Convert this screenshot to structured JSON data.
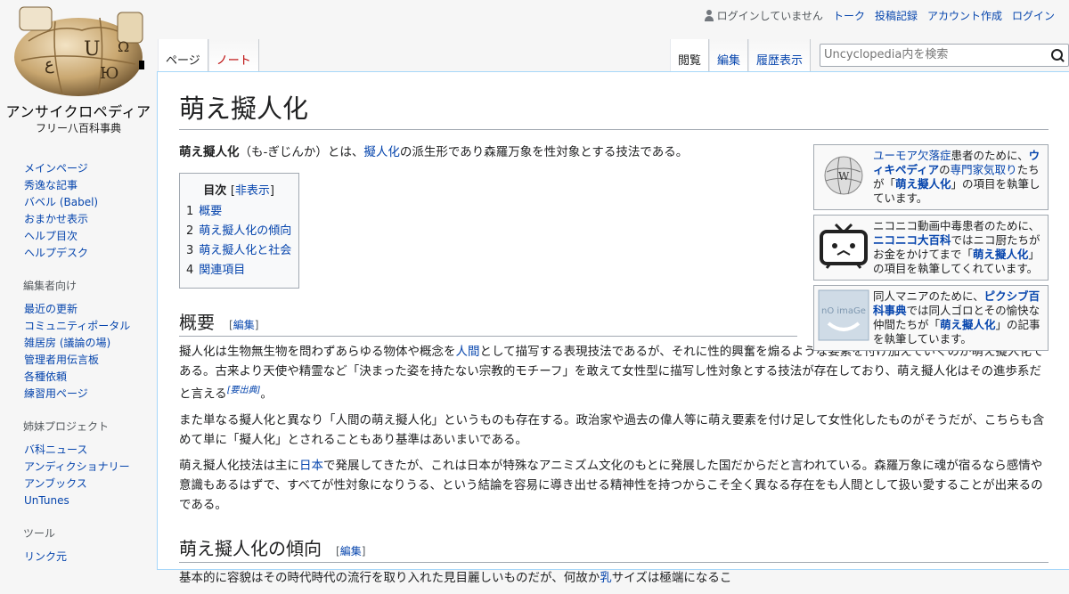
{
  "personal": {
    "not_logged_in": "ログインしていません",
    "talk": "トーク",
    "contributions": "投稿記録",
    "create_account": "アカウント作成",
    "login": "ログイン"
  },
  "logo": {
    "site_name": "アンサイクロペディア",
    "tagline": "フリー八百科事典"
  },
  "sidebar": {
    "nav": [
      "メインページ",
      "秀逸な記事",
      "バベル (Babel)",
      "おまかせ表示",
      "ヘルプ目次",
      "ヘルプデスク"
    ],
    "editors": {
      "heading": "編集者向け",
      "items": [
        "最近の更新",
        "コミュニティポータル",
        "雑居房 (議論の場)",
        "管理者用伝言板",
        "各種依頼",
        "練習用ページ"
      ]
    },
    "sister": {
      "heading": "姉妹プロジェクト",
      "items": [
        "バ科ニュース",
        "アンディクショナリー",
        "アンブックス",
        "UnTunes"
      ]
    },
    "tools": {
      "heading": "ツール",
      "items": [
        "リンク元"
      ]
    }
  },
  "tabs": {
    "page": "ページ",
    "talk": "ノート",
    "read": "閲覧",
    "edit": "編集",
    "history": "履歴表示"
  },
  "search": {
    "placeholder": "Uncyclopedia内を検索"
  },
  "article": {
    "title": "萌え擬人化",
    "lead": {
      "term": "萌え擬人化",
      "reading": "（も-ぎじんか）とは、",
      "link": "擬人化",
      "rest": "の派生形であり森羅万象を性対象とする技法である。"
    },
    "toc": {
      "title": "目次",
      "toggle_open": "[",
      "toggle": "非表示",
      "toggle_close": "]",
      "items": [
        {
          "num": "1",
          "label": "概要"
        },
        {
          "num": "2",
          "label": "萌え擬人化の傾向"
        },
        {
          "num": "3",
          "label": "萌え擬人化と社会"
        },
        {
          "num": "4",
          "label": "関連項目"
        }
      ]
    },
    "sections": {
      "overview": {
        "heading": "概要",
        "edit": "[編集]",
        "p1_a": "擬人化は生物無生物を問わずあらゆる物体や概念を",
        "p1_link": "人間",
        "p1_b": "として描写する表現技法であるが、それに性的興奮を煽るような要素を付け加えていくのが萌え擬人化である。古来より天使や精霊など「決まった姿を持たない宗教的モチーフ」を敢えて女性型に描写し性対象とする技法が存在しており、萌え擬人化はその進歩系だと言える",
        "p1_sup": "[要出典]",
        "p1_c": "。",
        "p2": "また単なる擬人化と異なり「人間の萌え擬人化」というものも存在する。政治家や過去の偉人等に萌え要素を付け足して女性化したものがそうだが、こちらも含めて単に「擬人化」とされることもあり基準はあいまいである。",
        "p3_a": "萌え擬人化技法は主に",
        "p3_link": "日本",
        "p3_b": "で発展してきたが、これは日本が特殊なアニミズム文化のもとに発展した国だからだと言われている。森羅万象に魂が宿るなら感情や意識もあるはずで、すべてが性対象になりうる、という結論を容易に導き出せる精神性を持つからこそ全く異なる存在をも人間として扱い愛することが出来るのである。"
      },
      "trend": {
        "heading": "萌え擬人化の傾向",
        "edit": "[編集]",
        "p1_a": "基本的に容貌はその時代時代の流行を取り入れた見目麗しいものだが、何故か",
        "p1_link": "乳",
        "p1_b": "サイズは極端になるこ"
      }
    },
    "boxes": [
      {
        "a": "ユーモア欠落症",
        "b": "患者のために、",
        "c": "ウィキペディア",
        "d": "の",
        "e": "専門家気取り",
        "f": "たちが「",
        "g": "萌え擬人化",
        "h": "」の項目を執筆しています。"
      },
      {
        "a": "ニコニコ動画中毒患者のために、",
        "b": "ニコニコ大百科",
        "c": "ではニコ厨たちがお金をかけてまで「",
        "d": "萌え擬人化",
        "e": "」の項目を執筆してくれています。"
      },
      {
        "a": "同人マニアのために、",
        "b": "ピクシブ百科事典",
        "c": "では同人ゴロとその愉快な仲間たちが「",
        "d": "萌え擬人化",
        "e": "」の記事を執筆しています。",
        "img_text": "nO imaGe"
      }
    ]
  }
}
